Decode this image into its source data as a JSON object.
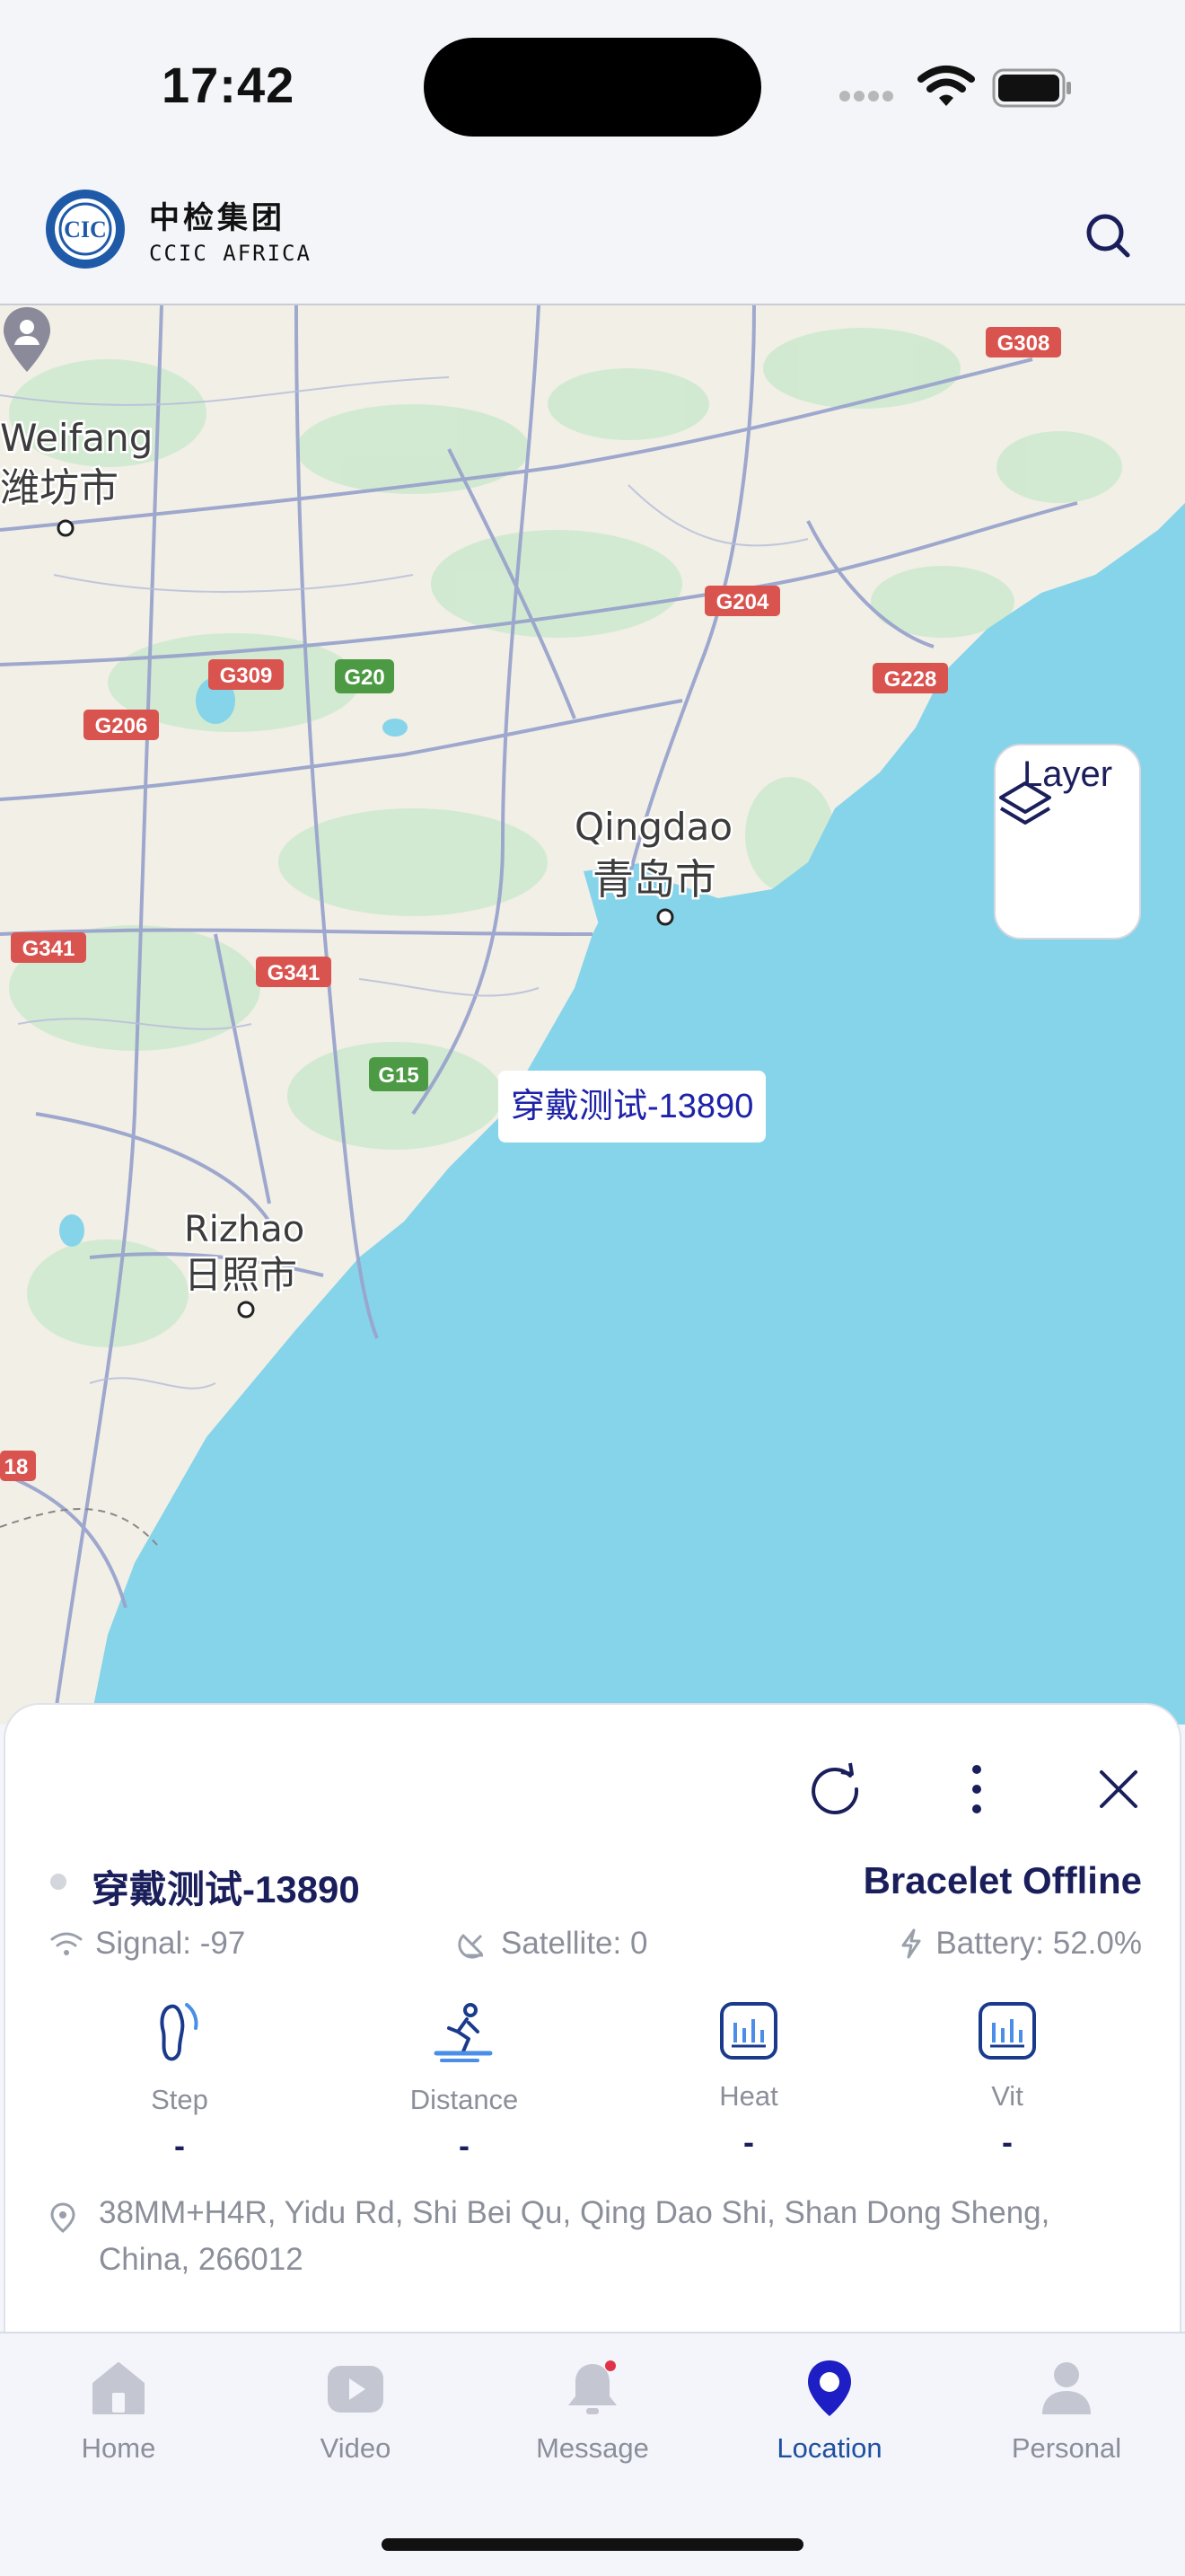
{
  "status_bar": {
    "time": "17:42"
  },
  "header": {
    "logo_cn": "中检集团",
    "logo_en": "CCIC AFRICA",
    "logo_mark": "CIC"
  },
  "map": {
    "layer_label": "Layer",
    "device_tooltip": "穿戴测试-13890",
    "city_labels": [
      {
        "en": "Weifang",
        "cn": "潍坊市"
      },
      {
        "en": "Qingdao",
        "cn": "青岛市"
      },
      {
        "en": "Rizhao",
        "cn": "日照市"
      }
    ],
    "road_shields": [
      "G308",
      "G204",
      "G309",
      "G20",
      "G206",
      "G228",
      "G341",
      "G341",
      "G15",
      "18"
    ]
  },
  "device_panel": {
    "name": "穿戴测试-13890",
    "status": "Bracelet Offline",
    "signal": "Signal: -97",
    "satellite": "Satellite: 0",
    "battery": "Battery: 52.0%",
    "metrics": [
      {
        "label": "Step",
        "value": "-"
      },
      {
        "label": "Distance",
        "value": "-"
      },
      {
        "label": "Heat",
        "value": "-"
      },
      {
        "label": "Vit",
        "value": "-"
      }
    ],
    "address": "38MM+H4R, Yidu Rd, Shi Bei Qu, Qing Dao Shi, Shan Dong Sheng, China, 266012"
  },
  "tabbar": {
    "tabs": [
      {
        "label": "Home"
      },
      {
        "label": "Video"
      },
      {
        "label": "Message"
      },
      {
        "label": "Location"
      },
      {
        "label": "Personal"
      }
    ],
    "active_tab": "Location"
  },
  "colors": {
    "sea": "#86d4ea",
    "land": "#f1efe6",
    "green_area": "#cfe9cf",
    "road": "#9aa4cc",
    "shield_red": "#d9534f",
    "shield_green": "#4d9a45",
    "accent_blue": "#1d22a8",
    "tab_active": "#1e4fa0",
    "tab_inactive": "#c4c7d1",
    "text_primary": "#1a1f5c",
    "text_muted": "#8b8f9a"
  }
}
